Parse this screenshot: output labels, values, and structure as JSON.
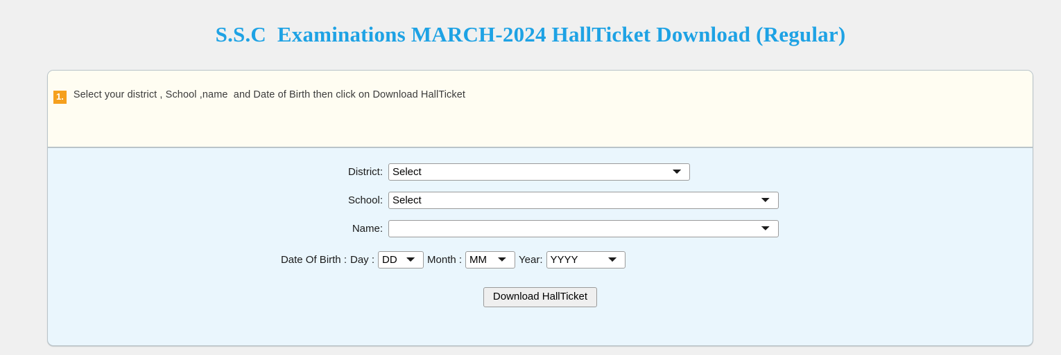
{
  "page": {
    "title": "S.S.C  Examinations MARCH-2024 HallTicket Download (Regular)",
    "title_color": "#1ea2e4",
    "background_color": "#f0f0f0"
  },
  "panel": {
    "background_color": "#eaf6fd",
    "note_background_color": "#fffdf2",
    "border_color": "#b9c4c9"
  },
  "note": {
    "badge": "1.",
    "badge_color": "#f5a01e",
    "text": "Select your district , School ,name  and Date of Birth then click on Download HallTicket"
  },
  "form": {
    "district": {
      "label": "District:",
      "value": "Select",
      "options": [
        "Select"
      ]
    },
    "school": {
      "label": "School:",
      "value": "Select",
      "options": [
        "Select"
      ]
    },
    "name": {
      "label": "Name:",
      "value": "",
      "options": [
        ""
      ]
    },
    "date_of_birth": {
      "label": "Date Of Birth :",
      "day_label": "Day :",
      "day_value": "DD",
      "day_options": [
        "DD"
      ],
      "month_label": "Month :",
      "month_value": "MM",
      "month_options": [
        "MM"
      ],
      "year_label": "Year:",
      "year_value": "YYYY",
      "year_options": [
        "YYYY"
      ]
    },
    "submit_label": "Download HallTicket"
  }
}
